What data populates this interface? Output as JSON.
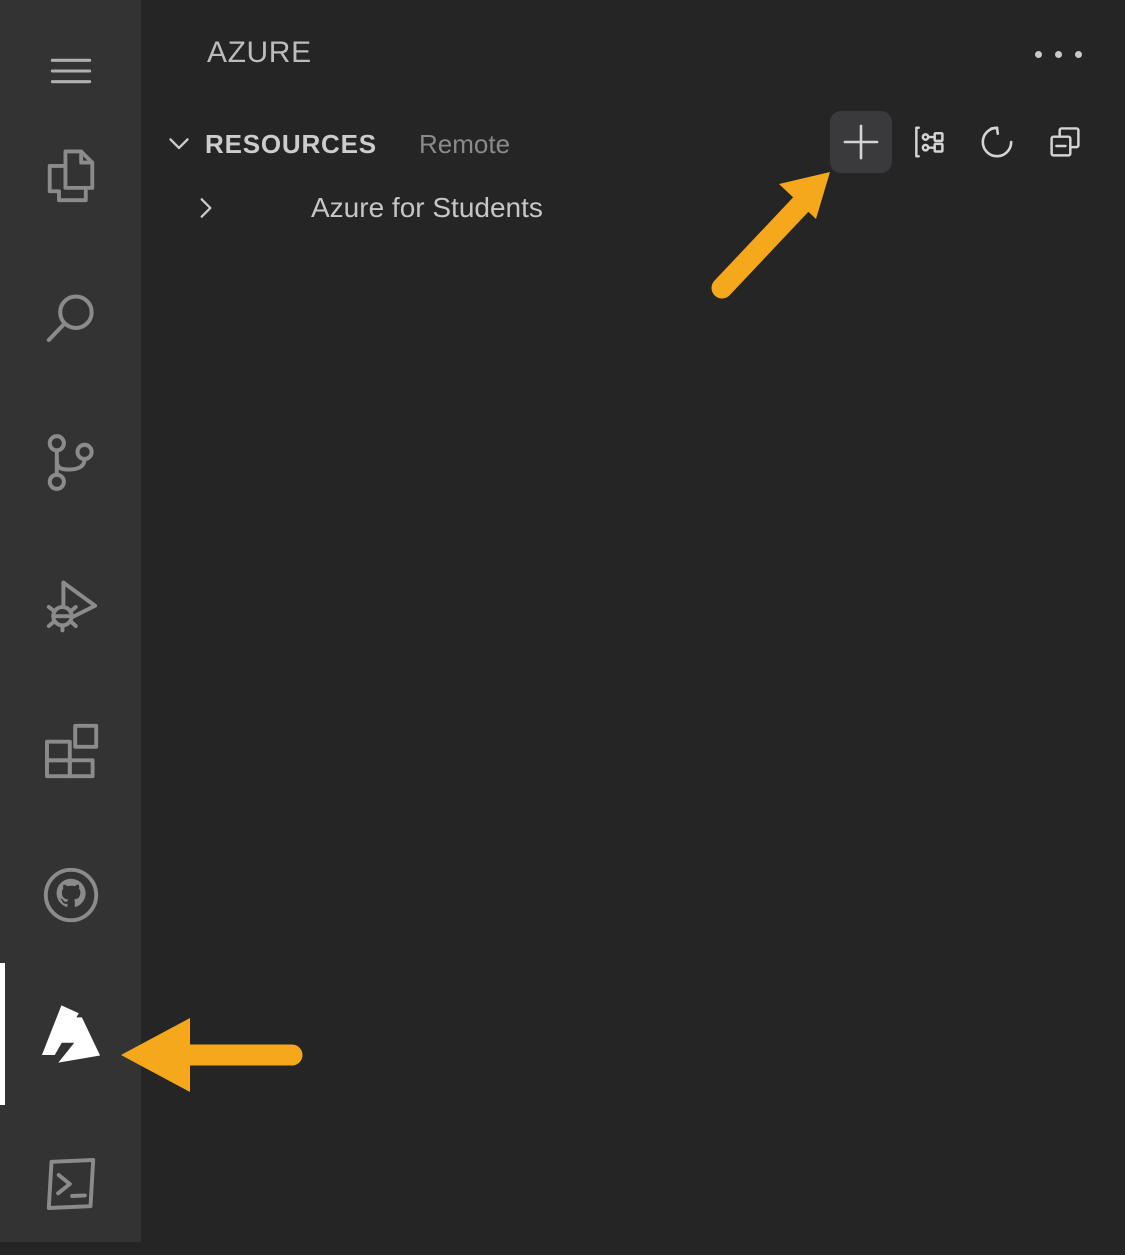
{
  "theme": {
    "activity_bar_bg": "#333333",
    "sidebar_bg": "#252526",
    "foreground": "#cccccc",
    "dim_foreground": "#8a8a8a",
    "active_indicator": "#ffffff",
    "annotation_orange": "#F5A81C",
    "button_hover_bg": "#3a3a3d"
  },
  "activity_bar": {
    "items": [
      {
        "name": "menu",
        "icon": "hamburger-menu-icon",
        "label": "Menu",
        "active": false
      },
      {
        "name": "explorer",
        "icon": "files-icon",
        "label": "Explorer",
        "active": false
      },
      {
        "name": "search",
        "icon": "search-icon",
        "label": "Search",
        "active": false
      },
      {
        "name": "source-control",
        "icon": "source-control-icon",
        "label": "Source Control",
        "active": false
      },
      {
        "name": "run-debug",
        "icon": "run-and-debug-icon",
        "label": "Run and Debug",
        "active": false
      },
      {
        "name": "extensions",
        "icon": "extensions-icon",
        "label": "Extensions",
        "active": false
      },
      {
        "name": "github",
        "icon": "github-icon",
        "label": "GitHub",
        "active": false
      },
      {
        "name": "azure",
        "icon": "azure-logo-icon",
        "label": "Azure",
        "active": true
      },
      {
        "name": "terminal",
        "icon": "terminal-icon",
        "label": "Terminal",
        "active": false
      }
    ]
  },
  "pane": {
    "title": "AZURE",
    "more_actions_label": "Views and More Actions..."
  },
  "section": {
    "title": "RESOURCES",
    "subtitle": "Remote",
    "expanded": true,
    "toolbar": [
      {
        "name": "create-resource",
        "icon": "plus-icon",
        "label": "Create Resource...",
        "active": true
      },
      {
        "name": "group-by",
        "icon": "group-by-icon",
        "label": "Group By...",
        "active": false
      },
      {
        "name": "refresh",
        "icon": "refresh-icon",
        "label": "Refresh",
        "active": false
      },
      {
        "name": "collapse-all",
        "icon": "collapse-all-icon",
        "label": "Collapse All",
        "active": false
      }
    ]
  },
  "tree": {
    "items": [
      {
        "label": "Azure for Students",
        "expanded": false,
        "indent": 1
      }
    ]
  },
  "annotations": [
    {
      "name": "arrow-to-create-resource",
      "direction": "up-right",
      "target": "create-resource"
    },
    {
      "name": "arrow-to-azure-activity-icon",
      "direction": "left",
      "target": "azure"
    }
  ]
}
